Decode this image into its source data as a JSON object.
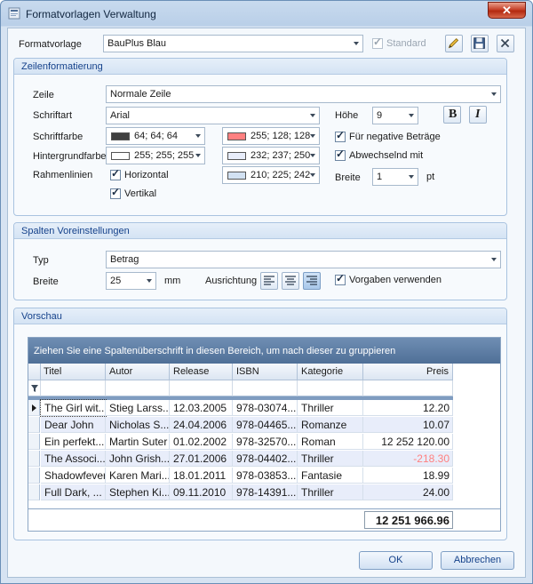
{
  "window": {
    "title": "Formatvorlagen Verwaltung",
    "close_glyph": "✕",
    "title_icon": "app-icon"
  },
  "top": {
    "formatvorlage_label": "Formatvorlage",
    "formatvorlage_value": "BauPlus Blau",
    "standard_label": "Standard",
    "standard_checked": true,
    "icons": [
      "pencil-icon",
      "save-icon",
      "close-icon"
    ]
  },
  "zeilen": {
    "group_title": "Zeilenformatierung",
    "zeile_label": "Zeile",
    "zeile_value": "Normale Zeile",
    "schriftart_label": "Schriftart",
    "schriftart_value": "Arial",
    "hoehe_label": "Höhe",
    "hoehe_value": "9",
    "bold_glyph": "B",
    "italic_glyph": "I",
    "schriftfarbe_label": "Schriftfarbe",
    "schriftfarbe_value": "64; 64; 64",
    "schriftfarbe_color": "#404040",
    "negative_value": "255; 128; 128",
    "negative_color": "#ff8080",
    "negative_label": "Für negative Beträge",
    "negative_checked": true,
    "hintergrund_label": "Hintergrundfarbe",
    "hintergrund_value": "255; 255; 255",
    "hintergrund_color": "#ffffff",
    "alt_value": "232; 237; 250",
    "alt_color": "#e8edfa",
    "abwechselnd_label": "Abwechselnd mit",
    "abwechselnd_checked": true,
    "rahmen_label": "Rahmenlinien",
    "horizontal_label": "Horizontal",
    "vertikal_label": "Vertikal",
    "rahmen_value": "210; 225; 242",
    "rahmen_color": "#d2e1f2",
    "breite_label": "Breite",
    "breite_value": "1",
    "breite_unit": "pt"
  },
  "spalten": {
    "group_title": "Spalten Voreinstellungen",
    "typ_label": "Typ",
    "typ_value": "Betrag",
    "breite_label": "Breite",
    "breite_value": "25",
    "breite_unit": "mm",
    "ausrichtung_label": "Ausrichtung",
    "vorgaben_label": "Vorgaben verwenden",
    "vorgaben_checked": true,
    "align_icons": [
      "align-left-icon",
      "align-center-icon",
      "align-right-icon"
    ]
  },
  "vorschau": {
    "group_title": "Vorschau",
    "group_panel_text": "Ziehen Sie eine Spaltenüberschrift in diesen Bereich, um nach dieser zu gruppieren",
    "columns": [
      "Titel",
      "Autor",
      "Release",
      "ISBN",
      "Kategorie",
      "Preis"
    ],
    "rows": [
      [
        "The Girl wit...",
        "Stieg Larss...",
        "12.03.2005",
        "978-03074...",
        "Thriller",
        "12.20"
      ],
      [
        "Dear John",
        "Nicholas S...",
        "24.04.2006",
        "978-04465...",
        "Romanze",
        "10.07"
      ],
      [
        "Ein perfekt...",
        "Martin Suter",
        "01.02.2002",
        "978-32570...",
        "Roman",
        "12 252 120.00"
      ],
      [
        "The Associ...",
        "John Grish...",
        "27.01.2006",
        "978-04402...",
        "Thriller",
        "-218.30"
      ],
      [
        "Shadowfever",
        "Karen Mari...",
        "18.01.2011",
        "978-03853...",
        "Fantasie",
        "18.99"
      ],
      [
        "Full Dark, ...",
        "Stephen Ki...",
        "09.11.2010",
        "978-14391...",
        "Thriller",
        "24.00"
      ]
    ],
    "total": "12 251 966.96",
    "negative_text_color": "#ff8080",
    "alt_row_color": "#e8edfa"
  },
  "buttons": {
    "ok": "OK",
    "cancel": "Abbrechen"
  }
}
